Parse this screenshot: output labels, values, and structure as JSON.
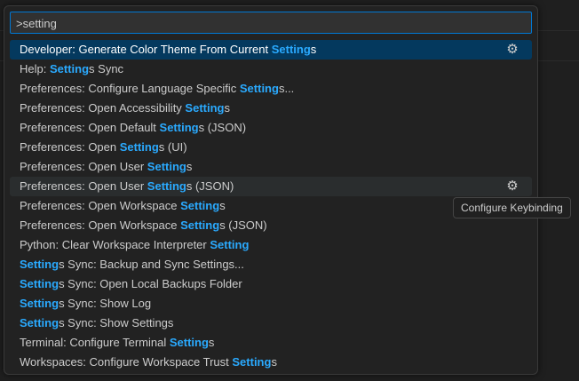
{
  "input": {
    "value": ">setting"
  },
  "tooltip": "Configure Keybinding",
  "items": [
    {
      "pre": "Developer: Generate Color Theme From Current ",
      "match": "Setting",
      "post": "s",
      "state": "sel",
      "gear": true
    },
    {
      "pre": "Help: ",
      "match": "Setting",
      "post": "s Sync"
    },
    {
      "pre": "Preferences: Configure Language Specific ",
      "match": "Setting",
      "post": "s..."
    },
    {
      "pre": "Preferences: Open Accessibility ",
      "match": "Setting",
      "post": "s"
    },
    {
      "pre": "Preferences: Open Default ",
      "match": "Setting",
      "post": "s (JSON)"
    },
    {
      "pre": "Preferences: Open ",
      "match": "Setting",
      "post": "s (UI)"
    },
    {
      "pre": "Preferences: Open User ",
      "match": "Setting",
      "post": "s"
    },
    {
      "pre": "Preferences: Open User ",
      "match": "Setting",
      "post": "s (JSON)",
      "state": "hov",
      "gear": true
    },
    {
      "pre": "Preferences: Open Workspace ",
      "match": "Setting",
      "post": "s"
    },
    {
      "pre": "Preferences: Open Workspace ",
      "match": "Setting",
      "post": "s (JSON)"
    },
    {
      "pre": "Python: Clear Workspace Interpreter ",
      "match": "Setting",
      "post": ""
    },
    {
      "pre": "",
      "match": "Setting",
      "post": "s Sync: Backup and Sync Settings..."
    },
    {
      "pre": "",
      "match": "Setting",
      "post": "s Sync: Open Local Backups Folder"
    },
    {
      "pre": "",
      "match": "Setting",
      "post": "s Sync: Show Log"
    },
    {
      "pre": "",
      "match": "Setting",
      "post": "s Sync: Show Settings"
    },
    {
      "pre": "Terminal: Configure Terminal ",
      "match": "Setting",
      "post": "s"
    },
    {
      "pre": "Workspaces: Configure Workspace Trust ",
      "match": "Setting",
      "post": "s"
    }
  ]
}
